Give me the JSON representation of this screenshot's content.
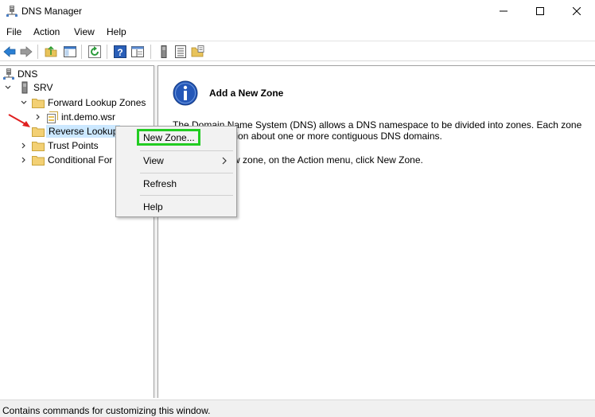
{
  "window": {
    "title": "DNS Manager",
    "app_icon": "dns-manager-icon"
  },
  "menubar": {
    "items": [
      "File",
      "Action",
      "View",
      "Help"
    ]
  },
  "toolbar": {
    "icons": [
      "back-icon",
      "forward-icon",
      "up-folder-icon",
      "show-hide-tree-icon",
      "refresh-icon",
      "help-icon",
      "console-view-icon",
      "server-icon",
      "list-icon",
      "folder-properties-icon"
    ]
  },
  "tree": {
    "root": "DNS",
    "server": "SRV",
    "forward_lookup_zones": "Forward Lookup Zones",
    "zone": "int.demo.wsr",
    "reverse_lookup_zones": "Reverse Lookup",
    "trust_points": "Trust Points",
    "conditional_forwarders": "Conditional For"
  },
  "detail": {
    "heading": "Add a New Zone",
    "description": "The Domain Name System (DNS) allows a DNS namespace to be divided into zones. Each zone\nstores information about one or more contiguous DNS domains.",
    "instruction": "To create a new zone, on the Action menu, click New Zone."
  },
  "context_menu": {
    "new_zone": "New Zone...",
    "view": "View",
    "refresh": "Refresh",
    "help": "Help"
  },
  "status_bar": {
    "text": "Contains commands for customizing this window."
  },
  "colors": {
    "highlight": "#cce8ff",
    "callout_box": "#22cc22",
    "arrow": "#e02020",
    "info_blue": "#2457b8"
  }
}
